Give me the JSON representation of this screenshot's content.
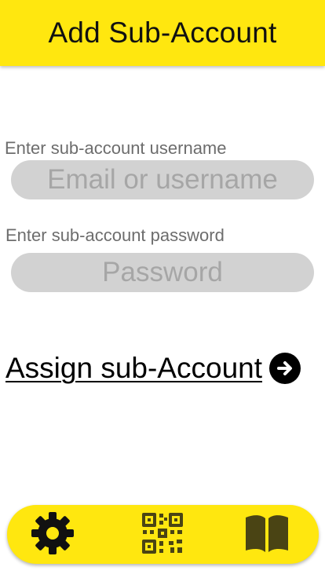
{
  "header": {
    "title": "Add Sub-Account"
  },
  "form": {
    "username_label": "Enter sub-account username",
    "username_placeholder": "Email or username",
    "password_label": "Enter sub-account password",
    "password_placeholder": "Password",
    "assign_label": "Assign sub-Account"
  },
  "bottom_nav": {
    "items": [
      {
        "icon": "gear-icon"
      },
      {
        "icon": "qr-code-icon"
      },
      {
        "icon": "book-icon"
      }
    ]
  },
  "colors": {
    "accent": "#ffe70f",
    "input_bg": "#d2d2d2",
    "label": "#6d6d6d",
    "icon_dark": "#4a4414"
  }
}
